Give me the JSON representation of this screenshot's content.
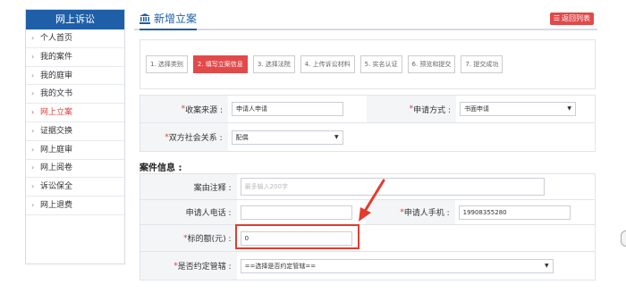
{
  "sidebar": {
    "title": "网上诉讼",
    "items": [
      {
        "label": "个人首页",
        "active": false
      },
      {
        "label": "我的案件",
        "active": false
      },
      {
        "label": "我的庭审",
        "active": false
      },
      {
        "label": "我的文书",
        "active": false
      },
      {
        "label": "网上立案",
        "active": true
      },
      {
        "label": "证据交换",
        "active": false
      },
      {
        "label": "网上庭审",
        "active": false
      },
      {
        "label": "网上阅卷",
        "active": false
      },
      {
        "label": "诉讼保全",
        "active": false
      },
      {
        "label": "网上退费",
        "active": false
      }
    ]
  },
  "header": {
    "title": "新增立案",
    "back_label": "返回列表"
  },
  "steps": [
    {
      "label": "1. 选择类别",
      "active": false
    },
    {
      "label": "2. 填写立案信息",
      "active": true
    },
    {
      "label": "3. 选择法院",
      "active": false
    },
    {
      "label": "4. 上传诉讼材料",
      "active": false
    },
    {
      "label": "5. 实名认证",
      "active": false
    },
    {
      "label": "6. 预览和提交",
      "active": false
    },
    {
      "label": "7. 提交成功",
      "active": false
    }
  ],
  "form": {
    "source_label": "收案来源 :",
    "source_value": "申请人申请",
    "method_label": "申请方式 :",
    "method_value": "书面申请",
    "relation_label": "双方社会关系 :",
    "relation_value": "配偶",
    "section_title": "案件信息 :",
    "reason_label": "案由注释 :",
    "reason_placeholder": "最多输入200字",
    "phone_label": "申请人电话 :",
    "phone_value": "",
    "mobile_label": "申请人手机 :",
    "mobile_value": "19908355280",
    "amount_label": "标的额(元) :",
    "amount_value": "0",
    "jurisdiction_label": "是否约定管辖 :",
    "jurisdiction_value": "==选择是否约定管辖=="
  },
  "colors": {
    "primary": "#1f5fa8",
    "accent_red": "#e24a4a",
    "highlight": "#e33b2e"
  }
}
